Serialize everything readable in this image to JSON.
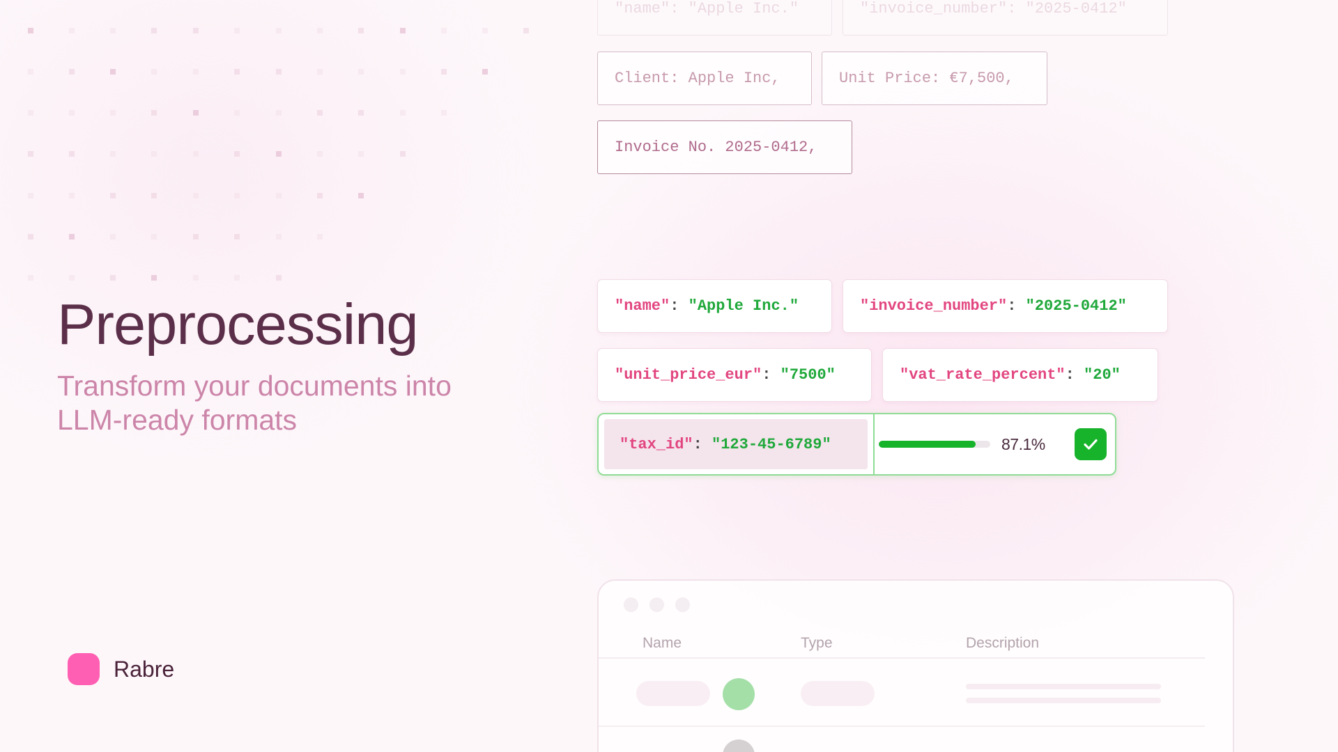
{
  "hero": {
    "title": "Preprocessing",
    "subtitle": "Transform your documents into LLM-ready formats"
  },
  "brand": {
    "name": "Rabre",
    "logo_color": "#ff5fb2"
  },
  "raw_tokens": [
    {
      "text": "\"name\": \"Apple Inc.\""
    },
    {
      "text": "\"invoice_number\": \"2025-0412\""
    },
    {
      "text": "Client: Apple Inc,"
    },
    {
      "text": "Unit Price: €7,500,"
    },
    {
      "text": "Invoice No. 2025-0412,"
    }
  ],
  "json_fields": [
    {
      "key": "\"name\"",
      "value": "\"Apple Inc.\""
    },
    {
      "key": "\"invoice_number\"",
      "value": "\"2025-0412\""
    },
    {
      "key": "\"unit_price_eur\"",
      "value": "\"7500\""
    },
    {
      "key": "\"vat_rate_percent\"",
      "value": "\"20\""
    }
  ],
  "validated_field": {
    "key": "\"tax_id\"",
    "value": "\"123-45-6789\"",
    "confidence_label": "87.1%",
    "confidence": 0.871,
    "status_icon": "check-icon"
  },
  "table": {
    "columns": [
      "Name",
      "Type",
      "Description"
    ]
  },
  "colors": {
    "key": "#e2457f",
    "value": "#1fa83a",
    "accent_green": "#17b32b",
    "title": "#5b2f49",
    "subtitle": "#cc85a9"
  }
}
